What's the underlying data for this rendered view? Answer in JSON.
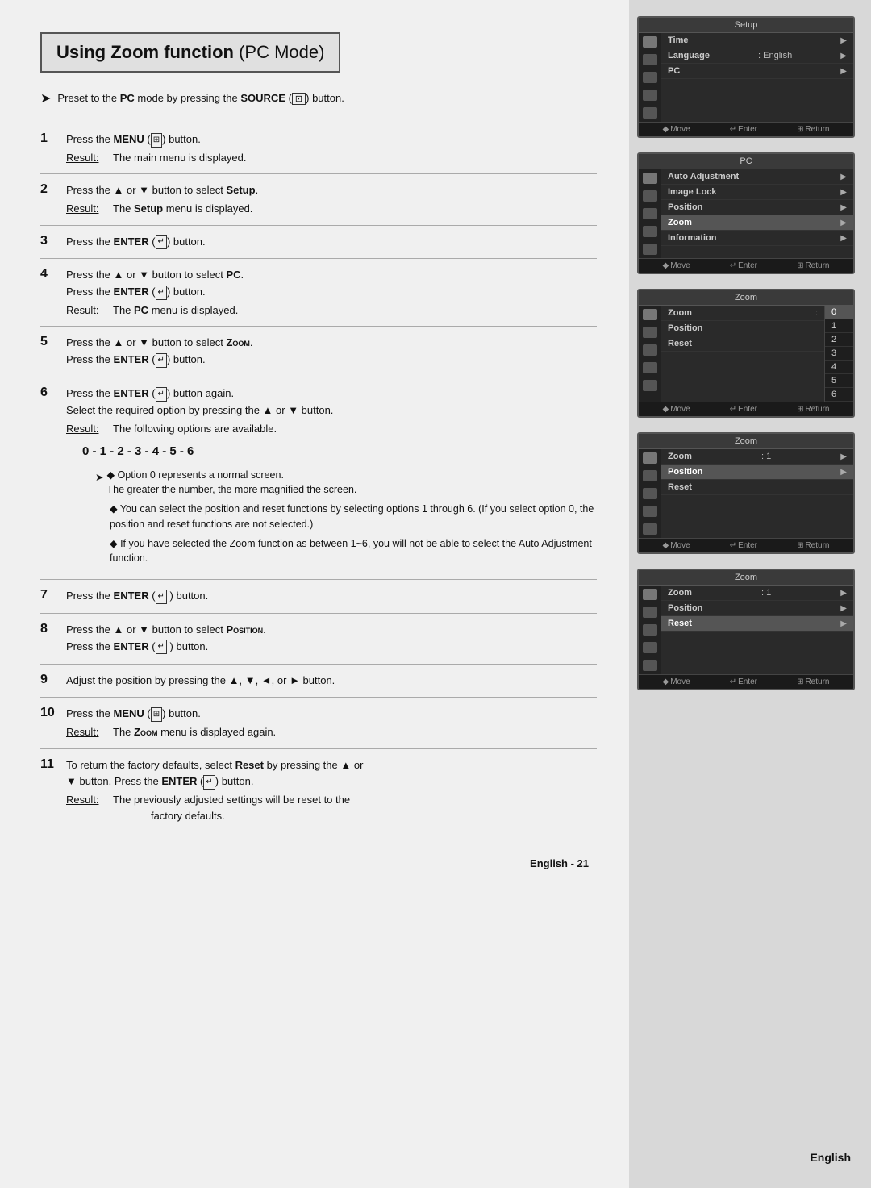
{
  "page": {
    "title": {
      "bold": "Using Zoom function",
      "normal": " (PC Mode)"
    },
    "preset_line": "Preset to the PC mode by pressing the SOURCE (    ) button.",
    "footer": {
      "language": "English",
      "page_number": "21"
    }
  },
  "steps": [
    {
      "num": "1",
      "instruction": "Press the MENU (     ) button.",
      "result_label": "Result:",
      "result_text": "The main menu is displayed."
    },
    {
      "num": "2",
      "instruction": "Press the ▲ or ▼ button to select Setup.",
      "result_label": "Result:",
      "result_text": "The Setup menu is displayed."
    },
    {
      "num": "3",
      "instruction": "Press the ENTER (    ) button."
    },
    {
      "num": "4",
      "instruction": "Press the ▲ or ▼ button to select PC.\nPress the ENTER (    ) button.",
      "result_label": "Result:",
      "result_text": "The PC menu is displayed."
    },
    {
      "num": "5",
      "instruction": "Press the ▲ or ▼ button to select Zoom.\nPress the ENTER (    ) button."
    },
    {
      "num": "6",
      "instruction": "Press the ENTER (    ) button again.\nSelect the required option by pressing the ▲ or ▼ button.",
      "result_label": "Result:",
      "result_text": "The following options are available.",
      "options": "0 - 1 - 2 - 3 - 4 - 5 - 6",
      "bullets": [
        "◆ Option 0 represents a normal screen.\n  The greater the number, the more magnified the screen.",
        "◆ You can select the position and reset functions by selecting options 1 through 6. (If you select option 0, the position and reset functions are not selected.)",
        "◆ If you have selected the Zoom function as between 1~6, you will not be able to select the Auto Adjustment function."
      ]
    },
    {
      "num": "7",
      "instruction": "Press the ENTER (    ) button."
    },
    {
      "num": "8",
      "instruction": "Press the ▲ or ▼ button to select Position.\nPress the ENTER (    ) button."
    },
    {
      "num": "9",
      "instruction": "Adjust the position by pressing the ▲, ▼, ◄, or ► button."
    },
    {
      "num": "10",
      "instruction": "Press the MENU (     ) button.",
      "result_label": "Result:",
      "result_text": "The Zoom menu is displayed again."
    },
    {
      "num": "11",
      "instruction": "To return the factory defaults, select Reset by pressing the ▲ or ▼ button. Press the ENTER (    ) button.",
      "result_label": "Result:",
      "result_text": "The previously adjusted settings will be reset to the factory defaults."
    }
  ],
  "screens": [
    {
      "id": "setup",
      "title": "Setup",
      "menu_items": [
        {
          "label": "Time",
          "value": "",
          "highlighted": false,
          "bold": true
        },
        {
          "label": "Language",
          "value": ": English",
          "highlighted": false
        },
        {
          "label": "PC",
          "value": "",
          "highlighted": false
        }
      ]
    },
    {
      "id": "pc",
      "title": "PC",
      "menu_items": [
        {
          "label": "Auto Adjustment",
          "value": "",
          "highlighted": false
        },
        {
          "label": "Image Lock",
          "value": "",
          "highlighted": false
        },
        {
          "label": "Position",
          "value": "",
          "highlighted": false
        },
        {
          "label": "Zoom",
          "value": "",
          "highlighted": true
        },
        {
          "label": "Information",
          "value": "",
          "highlighted": false
        }
      ]
    },
    {
      "id": "zoom-list",
      "title": "Zoom",
      "menu_items": [
        {
          "label": "Zoom",
          "value": ":",
          "highlighted": false
        },
        {
          "label": "Position",
          "value": "",
          "highlighted": false
        },
        {
          "label": "Reset",
          "value": "",
          "highlighted": false
        }
      ],
      "zoom_numbers": [
        "0",
        "1",
        "2",
        "3",
        "4",
        "5",
        "6"
      ]
    },
    {
      "id": "zoom-position",
      "title": "Zoom",
      "menu_items": [
        {
          "label": "Zoom",
          "value": ": 1",
          "highlighted": false
        },
        {
          "label": "Position",
          "value": "",
          "highlighted": true
        },
        {
          "label": "Reset",
          "value": "",
          "highlighted": false
        }
      ]
    },
    {
      "id": "zoom-reset",
      "title": "Zoom",
      "menu_items": [
        {
          "label": "Zoom",
          "value": ": 1",
          "highlighted": false
        },
        {
          "label": "Position",
          "value": "",
          "highlighted": false
        },
        {
          "label": "Reset",
          "value": "",
          "highlighted": true
        }
      ]
    }
  ],
  "bottom_bar": {
    "move": "◆ Move",
    "enter": "↵ Enter",
    "return": "⊞ Return"
  }
}
